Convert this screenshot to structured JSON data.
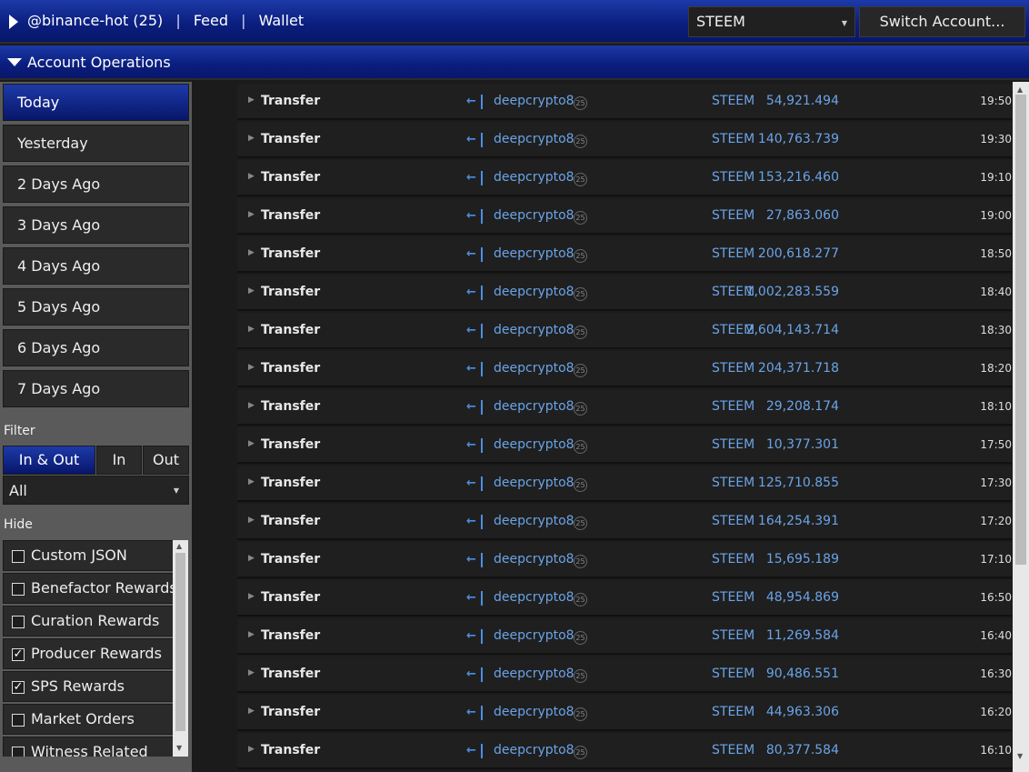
{
  "header": {
    "account": "@binance-hot (25)",
    "feed_label": "Feed",
    "wallet_label": "Wallet",
    "separator": "|",
    "coin_selected": "STEEM",
    "switch_account_label": "Switch Account..."
  },
  "section": {
    "title": "Account Operations"
  },
  "sidebar": {
    "days": [
      "Today",
      "Yesterday",
      "2 Days Ago",
      "3 Days Ago",
      "4 Days Ago",
      "5 Days Ago",
      "6 Days Ago",
      "7 Days Ago"
    ],
    "active_day": "Today",
    "filter_label": "Filter",
    "direction": [
      "In & Out",
      "In",
      "Out"
    ],
    "active_direction": "In & Out",
    "type_filter": "All",
    "hide_label": "Hide",
    "hide_items": [
      {
        "label": "Custom JSON",
        "checked": false
      },
      {
        "label": "Benefactor Rewards",
        "checked": false
      },
      {
        "label": "Curation Rewards",
        "checked": false
      },
      {
        "label": "Producer Rewards",
        "checked": true
      },
      {
        "label": "SPS Rewards",
        "checked": true
      },
      {
        "label": "Market Orders",
        "checked": false
      },
      {
        "label": "Witness Related",
        "checked": false
      }
    ]
  },
  "operations": [
    {
      "type": "Transfer",
      "account": "deepcrypto8",
      "rep": "25",
      "coin": "STEEM",
      "amount": "54,921.494",
      "time": "19:50"
    },
    {
      "type": "Transfer",
      "account": "deepcrypto8",
      "rep": "25",
      "coin": "STEEM",
      "amount": "140,763.739",
      "time": "19:30"
    },
    {
      "type": "Transfer",
      "account": "deepcrypto8",
      "rep": "25",
      "coin": "STEEM",
      "amount": "153,216.460",
      "time": "19:10"
    },
    {
      "type": "Transfer",
      "account": "deepcrypto8",
      "rep": "25",
      "coin": "STEEM",
      "amount": "27,863.060",
      "time": "19:00"
    },
    {
      "type": "Transfer",
      "account": "deepcrypto8",
      "rep": "25",
      "coin": "STEEM",
      "amount": "200,618.277",
      "time": "18:50"
    },
    {
      "type": "Transfer",
      "account": "deepcrypto8",
      "rep": "25",
      "coin": "STEEM",
      "amount": "1,002,283.559",
      "time": "18:40"
    },
    {
      "type": "Transfer",
      "account": "deepcrypto8",
      "rep": "25",
      "coin": "STEEM",
      "amount": "2,604,143.714",
      "time": "18:30"
    },
    {
      "type": "Transfer",
      "account": "deepcrypto8",
      "rep": "25",
      "coin": "STEEM",
      "amount": "204,371.718",
      "time": "18:20"
    },
    {
      "type": "Transfer",
      "account": "deepcrypto8",
      "rep": "25",
      "coin": "STEEM",
      "amount": "29,208.174",
      "time": "18:10"
    },
    {
      "type": "Transfer",
      "account": "deepcrypto8",
      "rep": "25",
      "coin": "STEEM",
      "amount": "10,377.301",
      "time": "17:50"
    },
    {
      "type": "Transfer",
      "account": "deepcrypto8",
      "rep": "25",
      "coin": "STEEM",
      "amount": "125,710.855",
      "time": "17:30"
    },
    {
      "type": "Transfer",
      "account": "deepcrypto8",
      "rep": "25",
      "coin": "STEEM",
      "amount": "164,254.391",
      "time": "17:20"
    },
    {
      "type": "Transfer",
      "account": "deepcrypto8",
      "rep": "25",
      "coin": "STEEM",
      "amount": "15,695.189",
      "time": "17:10"
    },
    {
      "type": "Transfer",
      "account": "deepcrypto8",
      "rep": "25",
      "coin": "STEEM",
      "amount": "48,954.869",
      "time": "16:50"
    },
    {
      "type": "Transfer",
      "account": "deepcrypto8",
      "rep": "25",
      "coin": "STEEM",
      "amount": "11,269.584",
      "time": "16:40"
    },
    {
      "type": "Transfer",
      "account": "deepcrypto8",
      "rep": "25",
      "coin": "STEEM",
      "amount": "90,486.551",
      "time": "16:30"
    },
    {
      "type": "Transfer",
      "account": "deepcrypto8",
      "rep": "25",
      "coin": "STEEM",
      "amount": "44,963.306",
      "time": "16:20"
    },
    {
      "type": "Transfer",
      "account": "deepcrypto8",
      "rep": "25",
      "coin": "STEEM",
      "amount": "80,377.584",
      "time": "16:10"
    }
  ],
  "icons": {
    "expand": "play-triangle-icon",
    "collapse": "triangle-down-icon",
    "row_expand": "chevron-right-icon",
    "incoming": "incoming-arrow-icon",
    "reputation": "reputation-badge-icon",
    "checkbox": "checkbox-icon"
  },
  "colors": {
    "accent": "#0b1f80",
    "link": "#6aa4e8",
    "background": "#1b1b1b"
  }
}
